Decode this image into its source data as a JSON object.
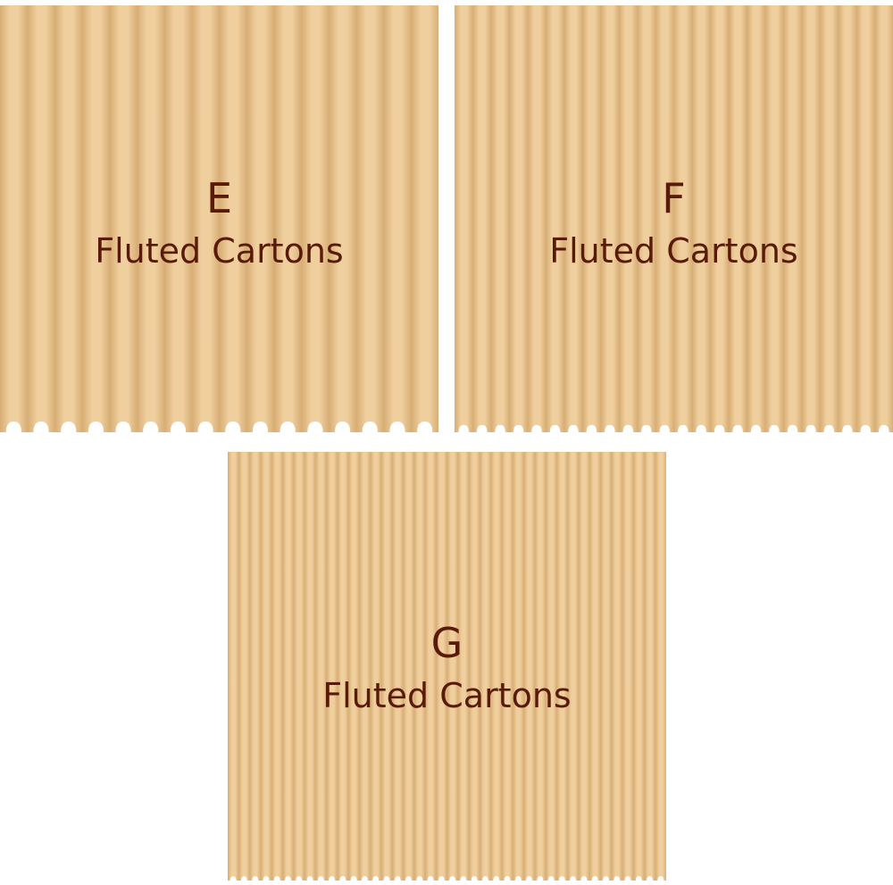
{
  "panels": [
    {
      "id": "e",
      "flute_letter": "E",
      "caption": "Fluted Cartons",
      "flutes_per_panel": 16
    },
    {
      "id": "f",
      "flute_letter": "F",
      "caption": "Fluted Cartons",
      "flutes_per_panel": 24
    },
    {
      "id": "g",
      "flute_letter": "G",
      "caption": "Fluted Cartons",
      "flutes_per_panel": 40
    }
  ],
  "colors": {
    "cardboard_light": "#f0cf9e",
    "cardboard_shadow": "#d6ad74",
    "text": "#5a1a0a",
    "background": "#ffffff"
  }
}
